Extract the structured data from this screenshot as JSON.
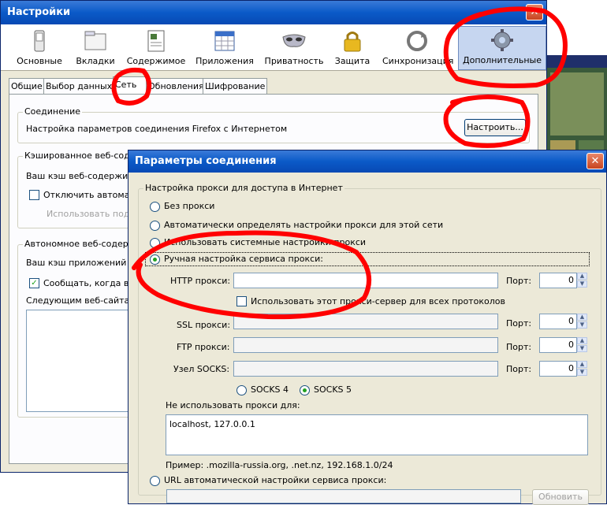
{
  "main_window": {
    "title": "Настройки",
    "close": "✕",
    "toolbar": [
      {
        "label": "Основные",
        "icon": "switch-icon"
      },
      {
        "label": "Вкладки",
        "icon": "folder-icon"
      },
      {
        "label": "Содержимое",
        "icon": "document-icon"
      },
      {
        "label": "Приложения",
        "icon": "calendar-icon"
      },
      {
        "label": "Приватность",
        "icon": "mask-icon"
      },
      {
        "label": "Защита",
        "icon": "lock-icon"
      },
      {
        "label": "Синхронизация",
        "icon": "sync-icon"
      },
      {
        "label": "Дополнительные",
        "icon": "gear-icon",
        "selected": true
      }
    ],
    "subtabs": [
      {
        "label": "Общие"
      },
      {
        "label": "Выбор данных"
      },
      {
        "label": "Сеть",
        "selected": true
      },
      {
        "label": "Обновления"
      },
      {
        "label": "Шифрование"
      }
    ],
    "connection": {
      "title": "Соединение",
      "text": "Настройка параметров соединения Firefox с Интернетом",
      "button": "Настроить..."
    },
    "cache": {
      "title": "Кэшированное веб-содер",
      "text": "Ваш кэш веб-содержимо",
      "checkbox_label": "Отключить автомат",
      "checked": false,
      "grey_text": "Использовать под к"
    },
    "offline": {
      "title": "Автономное веб-содерж",
      "text": "Ваш кэш приложений се",
      "checkbox_label": "Сообщать, когда ве",
      "checked": true,
      "list_label": "Следующим веб-сайтам"
    }
  },
  "dialog": {
    "title": "Параметры соединения",
    "close": "✕",
    "group_title": "Настройка прокси для доступа в Интернет",
    "options": [
      {
        "label": "Без прокси",
        "selected": false
      },
      {
        "label": "Автоматически определять настройки прокси для этой сети",
        "selected": false
      },
      {
        "label": "Использовать системные настройки прокси",
        "selected": false
      },
      {
        "label": "Ручная настройка сервиса прокси:",
        "selected": true
      }
    ],
    "http": {
      "label": "HTTP прокси:",
      "value": "",
      "port_label": "Порт:",
      "port": "0"
    },
    "all_protocols": {
      "label": "Использовать этот прокси-сервер для всех протоколов",
      "checked": false
    },
    "ssl": {
      "label": "SSL прокси:",
      "value": "",
      "port_label": "Порт:",
      "port": "0"
    },
    "ftp": {
      "label": "FTP прокси:",
      "value": "",
      "port_label": "Порт:",
      "port": "0"
    },
    "socks": {
      "label": "Узел SOCKS:",
      "value": "",
      "port_label": "Порт:",
      "port": "0"
    },
    "socks_versions": [
      {
        "label": "SOCKS 4",
        "selected": false
      },
      {
        "label": "SOCKS 5",
        "selected": true
      }
    ],
    "no_proxy_label": "Не использовать прокси для:",
    "no_proxy_value": "localhost, 127.0.0.1",
    "example": "Пример: .mozilla-russia.org, .net.nz, 192.168.1.0/24",
    "auto_url_label": "URL автоматической настройки сервиса прокси:",
    "reload_button": "Обновить"
  },
  "colors": {
    "annotation_red": "#ff0000",
    "xp_blue": "#0a5ac8",
    "check_green": "#21a121"
  }
}
